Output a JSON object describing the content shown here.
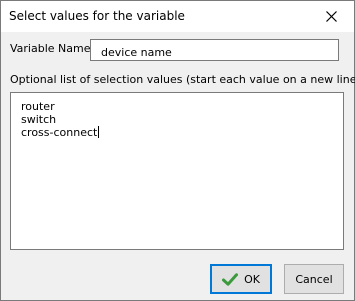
{
  "window": {
    "title": "Select values for the variable"
  },
  "form": {
    "variable_name_label": "Variable Name",
    "variable_name_value": "device name",
    "list_label": "Optional list of selection values (start each value on a new line)",
    "values": [
      "router",
      "switch",
      "cross-connect"
    ]
  },
  "buttons": {
    "ok_label": "OK",
    "cancel_label": "Cancel"
  },
  "icons": {
    "close": "close-icon",
    "ok": "checkmark-icon"
  },
  "colors": {
    "check_green": "#3c9a3c",
    "focus_border": "#0078d7"
  }
}
